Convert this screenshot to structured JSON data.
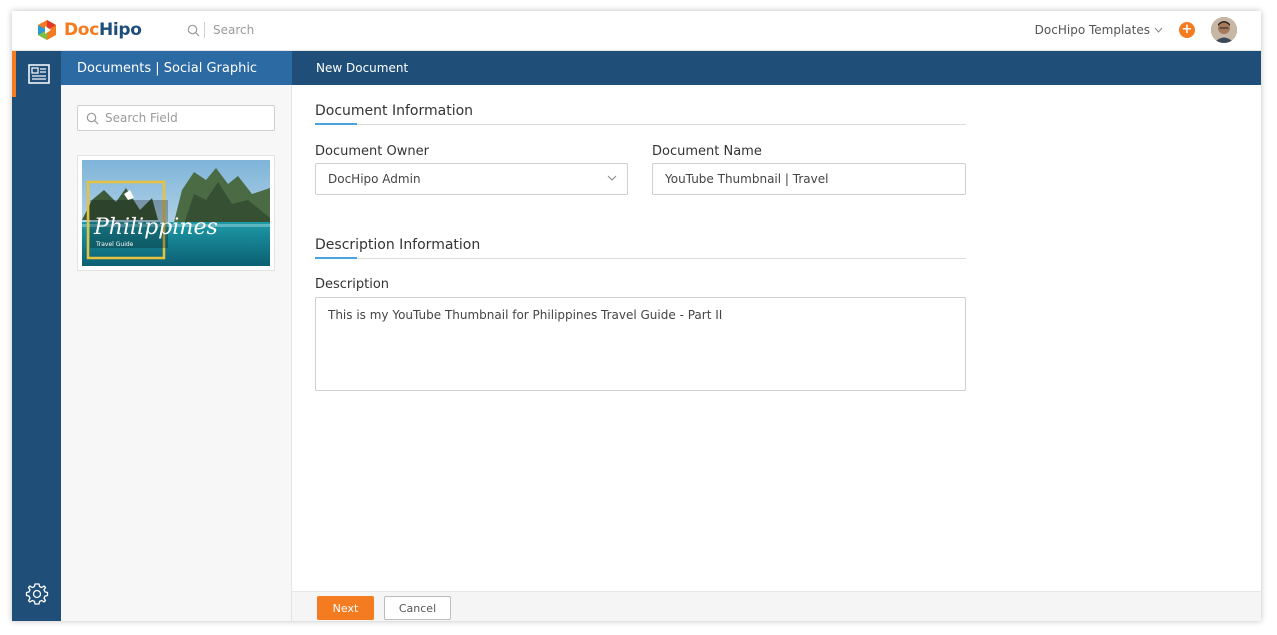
{
  "app": {
    "logo_text_part1": "Doc",
    "logo_text_part2": "Hipo",
    "search_placeholder": "Search",
    "templates_label": "DocHipo Templates",
    "plus_label": "+"
  },
  "header": {
    "breadcrumb": "Documents | Social Graphic",
    "page_title": "New Document"
  },
  "left_panel": {
    "search_field_placeholder": "Search Field",
    "thumbnail_title": "Philippines",
    "thumbnail_subtitle": "Travel Guide"
  },
  "form": {
    "document_info_title": "Document Information",
    "owner_label": "Document Owner",
    "owner_value": "DocHipo Admin",
    "name_label": "Document Name",
    "name_value": "YouTube Thumbnail | Travel",
    "description_info_title": "Description Information",
    "description_label": "Description",
    "description_value": "This is my YouTube Thumbnail for Philippines Travel Guide - Part II"
  },
  "footer": {
    "next_label": "Next",
    "cancel_label": "Cancel"
  },
  "colors": {
    "primary_blue": "#1f4e79",
    "secondary_blue": "#2b6aa3",
    "accent_orange": "#f47b20",
    "section_accent": "#4aa3df"
  },
  "icons": [
    "logo-icon",
    "search-icon",
    "chevron-down-icon",
    "plus-icon",
    "avatar",
    "document-icon",
    "gear-icon"
  ]
}
